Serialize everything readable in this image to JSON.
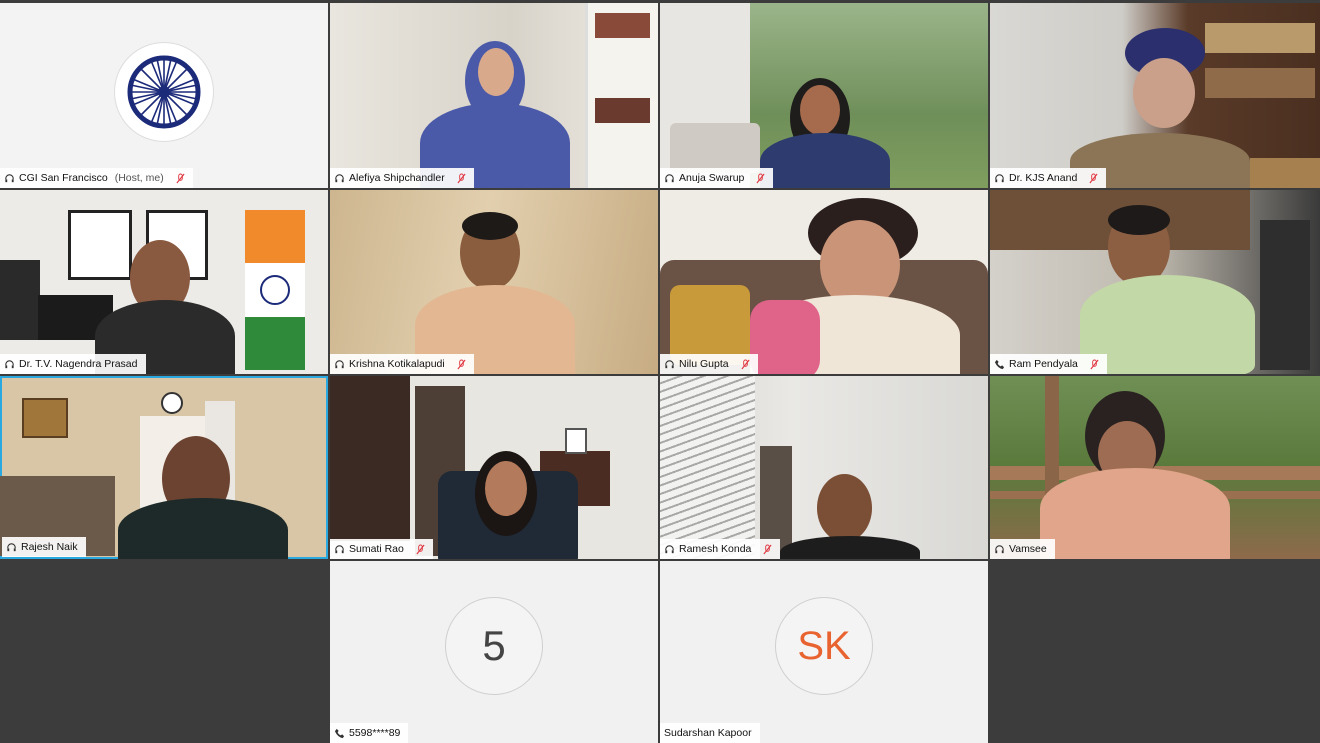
{
  "participants": [
    {
      "name": "CGI San Francisco",
      "note": "(Host, me)",
      "audio": "headset-icon",
      "muted": true
    },
    {
      "name": "Alefiya Shipchandler",
      "audio": "headset-icon",
      "muted": true
    },
    {
      "name": "Anuja Swarup",
      "audio": "headset-icon",
      "muted": true
    },
    {
      "name": "Dr. KJS Anand",
      "audio": "headset-icon",
      "muted": true
    },
    {
      "name": "Dr. T.V. Nagendra Prasad",
      "audio": "headset-icon",
      "muted": false
    },
    {
      "name": "Krishna Kotikalapudi",
      "audio": "headset-icon",
      "muted": true
    },
    {
      "name": "Nilu Gupta",
      "audio": "headset-icon",
      "muted": true
    },
    {
      "name": "Ram Pendyala",
      "audio": "phone-icon",
      "muted": true
    },
    {
      "name": "Rajesh Naik",
      "audio": "headset-icon",
      "muted": false,
      "active_speaker": true
    },
    {
      "name": "Sumati Rao",
      "audio": "headset-icon",
      "muted": true
    },
    {
      "name": "Ramesh Konda",
      "audio": "headset-icon",
      "muted": true
    },
    {
      "name": "Vamsee",
      "audio": "headset-icon",
      "muted": false
    },
    {
      "name": "5598****89",
      "avatar_text": "5",
      "audio": "phone-icon",
      "muted": false
    },
    {
      "name": "Sudarshan Kapoor",
      "avatar_text": "SK",
      "audio": "none",
      "muted": false
    }
  ],
  "colors": {
    "active_border": "#2aa8e0",
    "muted_icon": "#e0313b",
    "avatar_initials": "#e8632f",
    "empty_tile": "#3c3c3c"
  }
}
